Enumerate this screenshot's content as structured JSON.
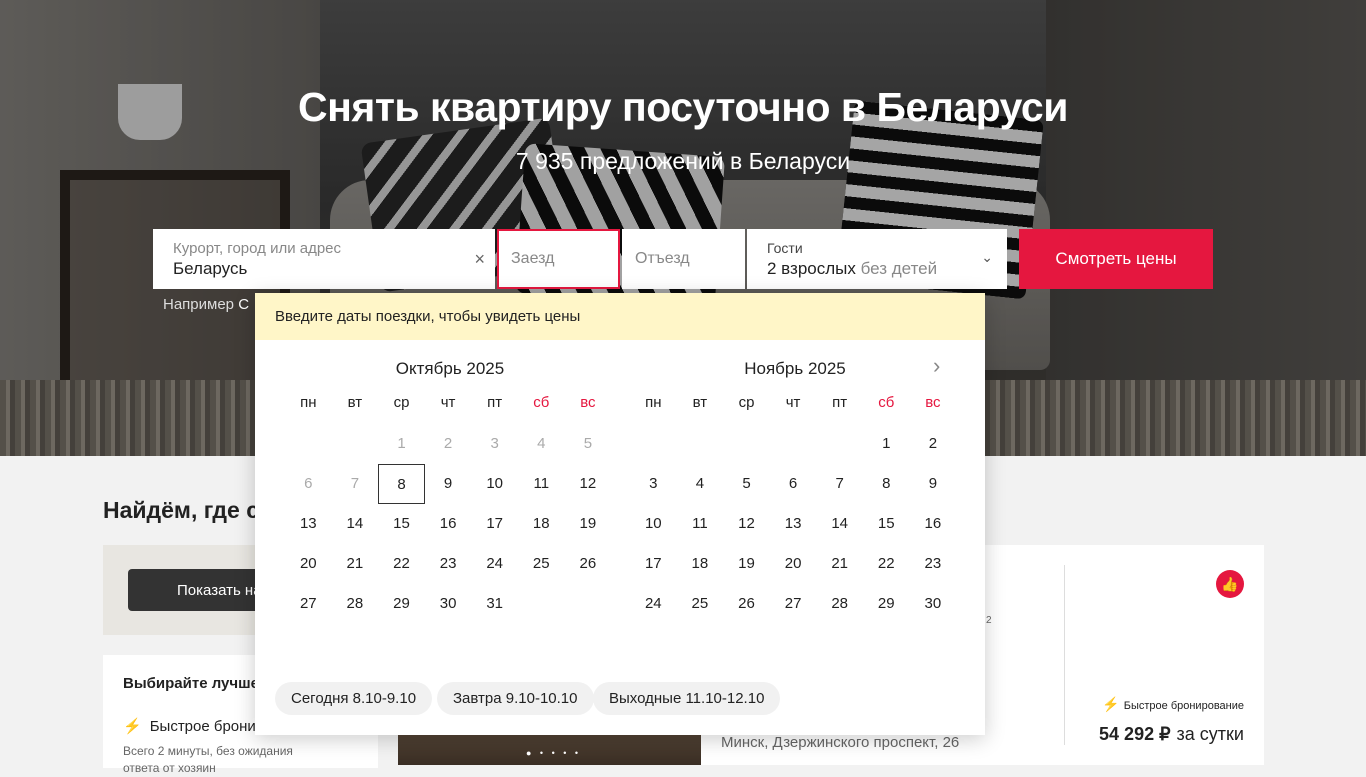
{
  "hero": {
    "title": "Снять квартиру посуточно в Беларуси",
    "subtitle": "7 935 предложений в Беларуси"
  },
  "search": {
    "location_label": "Курорт, город или адрес",
    "location_value": "Беларусь",
    "clear_icon": "×",
    "checkin_placeholder": "Заезд",
    "checkout_placeholder": "Отъезд",
    "guests_label": "Гости",
    "guests_value": "2 взрослых",
    "guests_children": "без детей",
    "guests_chevron": "⌄",
    "submit_label": "Смотреть цены"
  },
  "example": {
    "prefix": "Например",
    "value": "С"
  },
  "calendar": {
    "hint": "Введите даты поездки, чтобы увидеть цены",
    "next_icon": "›",
    "weekdays": [
      "пн",
      "вт",
      "ср",
      "чт",
      "пт",
      "сб",
      "вс"
    ],
    "months": [
      {
        "name": "Октябрь 2025",
        "offset": 2,
        "days": 31,
        "past_until": 7,
        "today": 8
      },
      {
        "name": "Ноябрь 2025",
        "offset": 5,
        "days": 30,
        "past_until": 0,
        "today": 0
      }
    ],
    "quick_options": [
      "Сегодня 8.10-9.10",
      "Завтра 9.10-10.10",
      "Выходные 11.10-12.10"
    ]
  },
  "below": {
    "section_title": "Найдём, где с",
    "map_button": "Показать на карте",
    "choose_title": "Выбирайте лучше",
    "fast_booking": "Быстрое бронир",
    "fast_desc": "Всего 2 минуты, без ожидания ответа от хозяин",
    "card_address": "Минск, Дзержинского проспект, 26",
    "card_fast": "Быстрое бронирование",
    "card_price": "54 292 ₽",
    "card_price_unit": "за сутки",
    "card_area_unit": "2"
  },
  "colors": {
    "accent": "#e5173f",
    "hint_bg": "#fff6c8"
  }
}
